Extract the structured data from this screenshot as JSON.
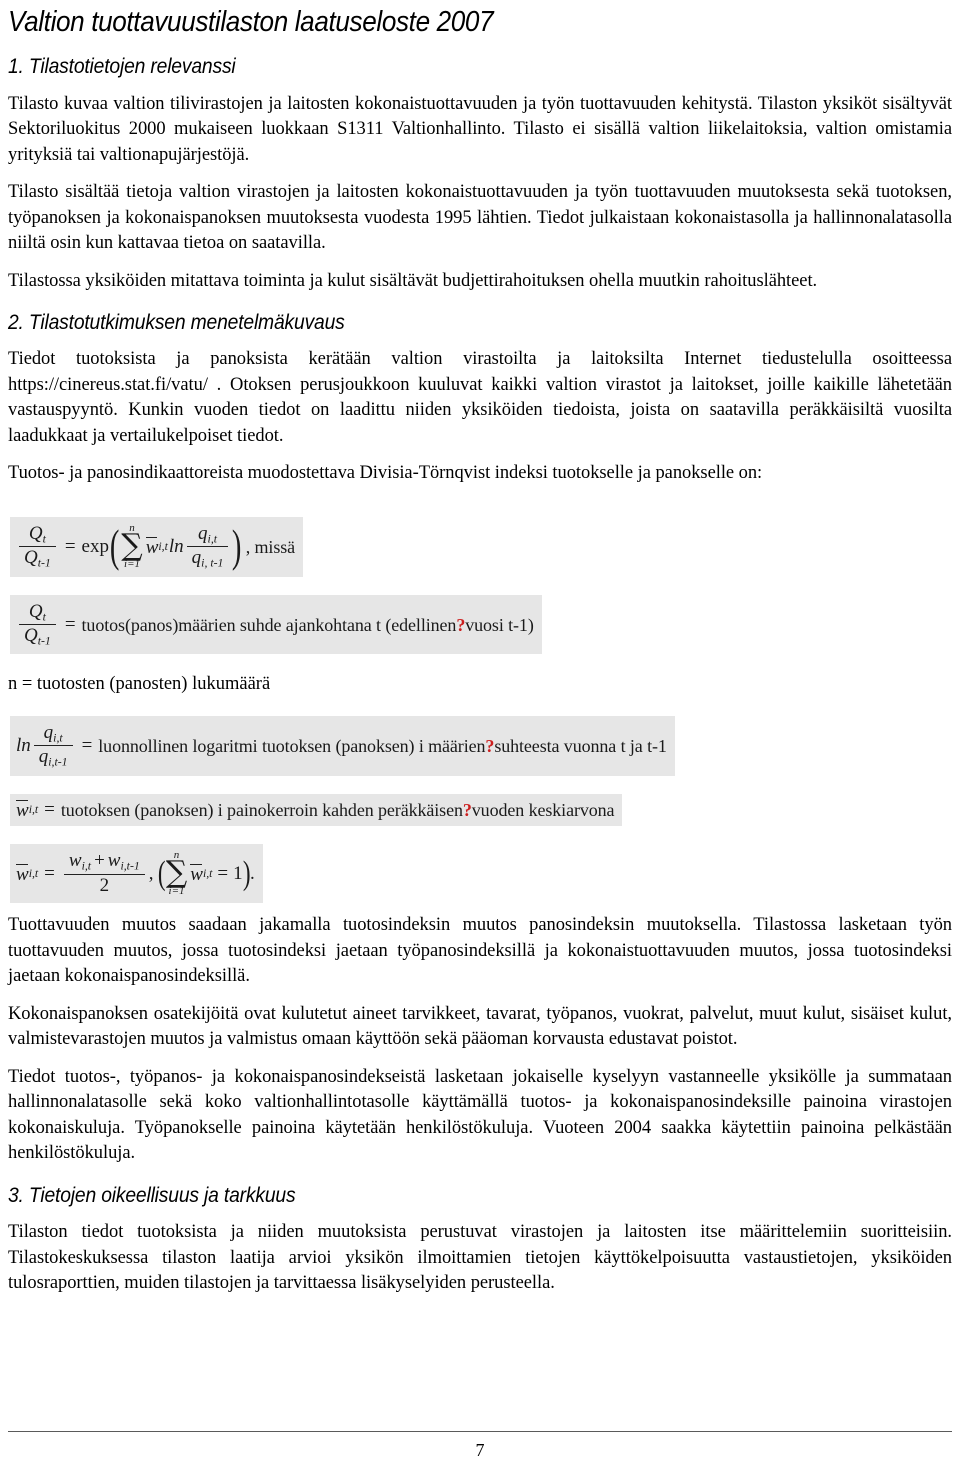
{
  "document": {
    "title": "Valtion tuottavuustilaston laatuseloste 2007",
    "page_number": "7"
  },
  "sections": [
    {
      "heading": "1. Tilastotietojen relevanssi",
      "paragraphs": [
        "Tilasto kuvaa valtion tilivirastojen ja laitosten kokonaistuottavuuden ja työn tuottavuuden kehitystä. Tilaston yksiköt sisältyvät Sektoriluokitus 2000 mukaiseen luokkaan S1311 Valtionhallinto. Tilasto ei sisällä valtion liikelaitoksia, valtion omistamia yrityksiä tai valtionapujärjestöjä.",
        "Tilasto sisältää tietoja valtion virastojen ja laitosten kokonaistuottavuuden ja työn tuottavuuden muutoksesta sekä tuotoksen, työpanoksen ja kokonaispanoksen muutoksesta vuodesta 1995 lähtien. Tiedot julkaistaan kokonaistasolla ja hallinnonalatasolla niiltä osin kun kattavaa tietoa on saatavilla.",
        "Tilastossa yksiköiden mitattava toiminta ja kulut sisältävät budjettirahoituksen ohella muutkin rahoituslähteet."
      ]
    },
    {
      "heading": "2. Tilastotutkimuksen menetelmäkuvaus",
      "paragraphs": [
        "Tiedot tuotoksista ja panoksista kerätään valtion virastoilta ja laitoksilta Internet tiedustelulla osoitteessa https://cinereus.stat.fi/vatu/ . Otoksen perusjoukkoon kuuluvat kaikki valtion virastot ja laitokset, joille kaikille lähetetään vastauspyyntö. Kunkin vuoden tiedot on laadittu niiden yksiköiden tiedoista, joista on saatavilla peräkkäisiltä vuosilta laadukkaat ja vertailukelpoiset tiedot.",
        "Tuotos- ja panosindikaattoreista muodostettava Divisia-Törnqvist indeksi tuotokselle ja panokselle on:"
      ],
      "paragraphs_after_formulas": [
        "Tuottavuuden muutos saadaan jakamalla tuotosindeksin muutos panosindeksin muutoksella. Tilastossa lasketaan työn tuottavuuden muutos, jossa tuotosindeksi jaetaan työpanosindeksillä ja kokonaistuottavuuden muutos, jossa tuotosindeksi jaetaan kokonaispanosindeksillä.",
        "Kokonaispanoksen osatekijöitä ovat kulutetut aineet tarvikkeet, tavarat, työpanos, vuokrat, palvelut, muut kulut, sisäiset kulut, valmistevarastojen muutos ja valmistus omaan käyttöön sekä pääoman korvausta edustavat poistot.",
        "Tiedot tuotos-, työpanos- ja kokonaispanosindekseistä lasketaan jokaiselle kyselyyn vastanneelle yksikölle ja summataan hallinnonalatasolle sekä koko valtionhallintotasolle käyttämällä tuotos- ja kokonaispanosindeksille painoina virastojen kokonaiskuluja. Työpanokselle painoina käytetään henkilöstökuluja. Vuoteen 2004 saakka käytettiin painoina pelkästään henkilöstökuluja."
      ]
    },
    {
      "heading": "3. Tietojen oikeellisuus ja tarkkuus",
      "paragraphs": [
        "Tilaston tiedot tuotoksista ja niiden muutoksista perustuvat virastojen ja laitosten itse määrittelemiin suoritteisiin. Tilastokeskuksessa tilaston laatija arvioi yksikön ilmoittamien tietojen käyttökelpoisuutta vastaustietojen, yksiköiden tulosraporttien, muiden tilastojen ja tarvittaessa lisäkyselyiden perusteella."
      ]
    }
  ],
  "formulas": {
    "divisia": {
      "numerator": "Q",
      "sub_t": "t",
      "sub_t1": "t-1",
      "equals": "=",
      "exp_label": "exp",
      "sum_upper": "n",
      "sum_lower": "i=1",
      "sum_glyph": "∑",
      "weight": "w",
      "weight_sub": "i,t",
      "ln_label": "ln",
      "q": "q",
      "q_sub_t": "i,t",
      "q_sub_t1": "i, t-1",
      "trailing_text": ", missä"
    },
    "q_ratio_definition": {
      "lhs_symbol": "Q",
      "sub_t": "t",
      "sub_t1": "t-1",
      "equals": "=",
      "text_before_marker": "tuotos(panos)määrien suhde ajankohtana t (edellinen",
      "marker": "?",
      "text_after_marker": "vuosi t-1)"
    },
    "n_definition": "n = tuotosten (panosten) lukumäärä",
    "ln_definition": {
      "ln_label": "ln",
      "q": "q",
      "q_sub_t": "i,t",
      "q_sub_t1": "i,t-1",
      "equals": "=",
      "text_before_marker": "luonnollinen logaritmi tuotoksen (panoksen) i määrien",
      "marker": "?",
      "text_after_marker": "suhteesta vuonna t ja t-1"
    },
    "weight_definition": {
      "weight": "w",
      "weight_sub": "i,t",
      "equals": "=",
      "text_before_marker": "tuotoksen (panoksen) i painokerroin kahden peräkkäisen",
      "marker": "?",
      "text_after_marker": "vuoden keskiarvona"
    },
    "weight_formula": {
      "lhs_weight": "w",
      "lhs_sub": "i,t",
      "equals": "=",
      "num_w1": "w",
      "num_w1_sub": "i,t",
      "plus": "+",
      "num_w2": "w",
      "num_w2_sub": "i,t-1",
      "denominator": "2",
      "comma": ",",
      "sum_upper": "n",
      "sum_lower": "i=1",
      "sum_glyph": "∑",
      "sum_weight": "w",
      "sum_weight_sub": "i,t",
      "sum_equals": "=",
      "sum_value": "1",
      "period": "."
    }
  },
  "colors": {
    "formula_background": "#e6e6e6",
    "marker_red": "#cc1f1f",
    "text": "#000000",
    "footer_rule": "#5a5a5a"
  }
}
